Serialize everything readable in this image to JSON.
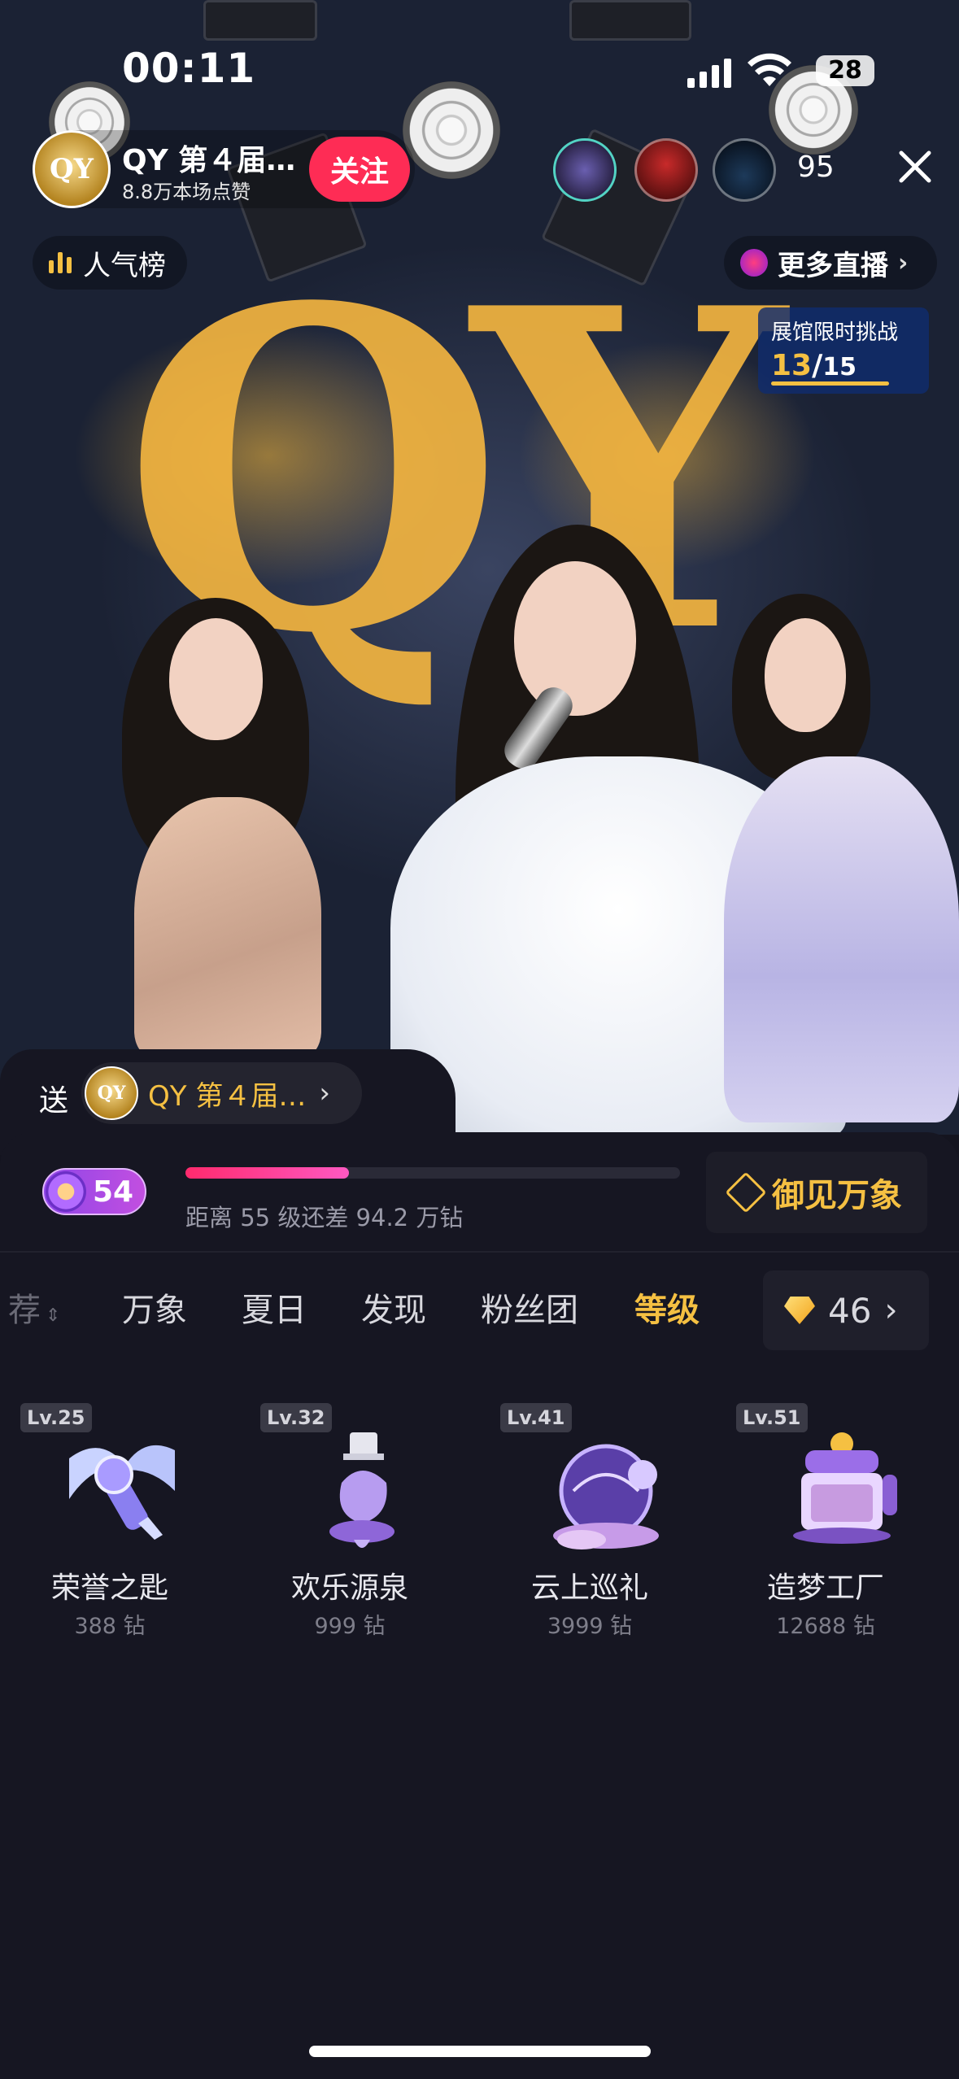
{
  "status_bar": {
    "time": "00:11",
    "battery": "28"
  },
  "host": {
    "avatar_text": "QY",
    "name": "QY 第４届…",
    "likes": "8.8万本场点赞",
    "follow_label": "关注"
  },
  "viewers": {
    "count": "95"
  },
  "stage": {
    "logo_text": "QY"
  },
  "popularity_label": "人气榜",
  "more_live_label": "更多直播",
  "challenge": {
    "title": "展馆限时挑战",
    "current": "13",
    "separator": "/",
    "total": "15"
  },
  "gift_panel": {
    "send_label": "送",
    "recipient": "QY 第４届…",
    "recipient_avatar_text": "QY",
    "user_level": "54",
    "progress_fraction": 0.33,
    "progress_text": "距离 55 级还差 94.2 万钻",
    "vip_label": "御见万象",
    "tabs": [
      {
        "label": "荐",
        "state": "faded"
      },
      {
        "label": "万象",
        "state": "normal"
      },
      {
        "label": "夏日",
        "state": "normal"
      },
      {
        "label": "发现",
        "state": "normal"
      },
      {
        "label": "粉丝团",
        "state": "normal"
      },
      {
        "label": "等级",
        "state": "active"
      }
    ],
    "balance": "46",
    "gifts": [
      {
        "level": "Lv.25",
        "name": "荣誉之匙",
        "price": "388 钻"
      },
      {
        "level": "Lv.32",
        "name": "欢乐源泉",
        "price": "999 钻"
      },
      {
        "level": "Lv.41",
        "name": "云上巡礼",
        "price": "3999 钻"
      },
      {
        "level": "Lv.51",
        "name": "造梦工厂",
        "price": "12688 钻"
      }
    ]
  },
  "colors": {
    "accent_gold": "#f5c042",
    "follow_pink": "#fe2c55",
    "panel_bg": "#161622"
  }
}
